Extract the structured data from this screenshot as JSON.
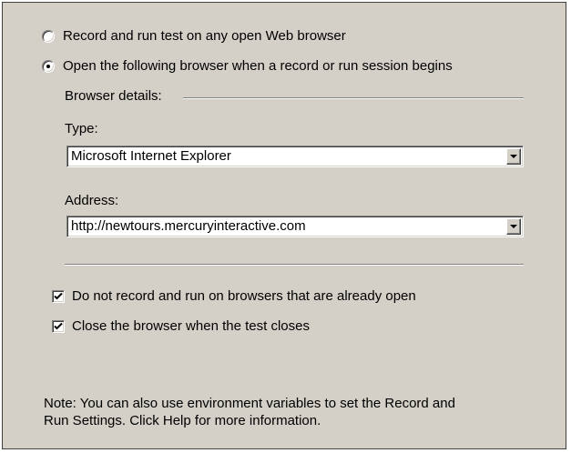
{
  "options": {
    "radio_any": {
      "label": "Record and run test on any open Web browser",
      "selected": false
    },
    "radio_open": {
      "label": "Open the following browser when a record or run session begins",
      "selected": true
    }
  },
  "browser_details": {
    "section_label": "Browser details:",
    "type_label": "Type:",
    "type_value": "Microsoft Internet Explorer",
    "address_label": "Address:",
    "address_value": "http://newtours.mercuryinteractive.com"
  },
  "checkboxes": {
    "no_record_open": {
      "label": "Do not record and run on browsers that are already open",
      "checked": true
    },
    "close_browser": {
      "label": "Close the browser when the test closes",
      "checked": true
    }
  },
  "note": {
    "line1": "Note: You can also use environment variables to set the Record and",
    "line2": "Run Settings.  Click Help for more information."
  }
}
